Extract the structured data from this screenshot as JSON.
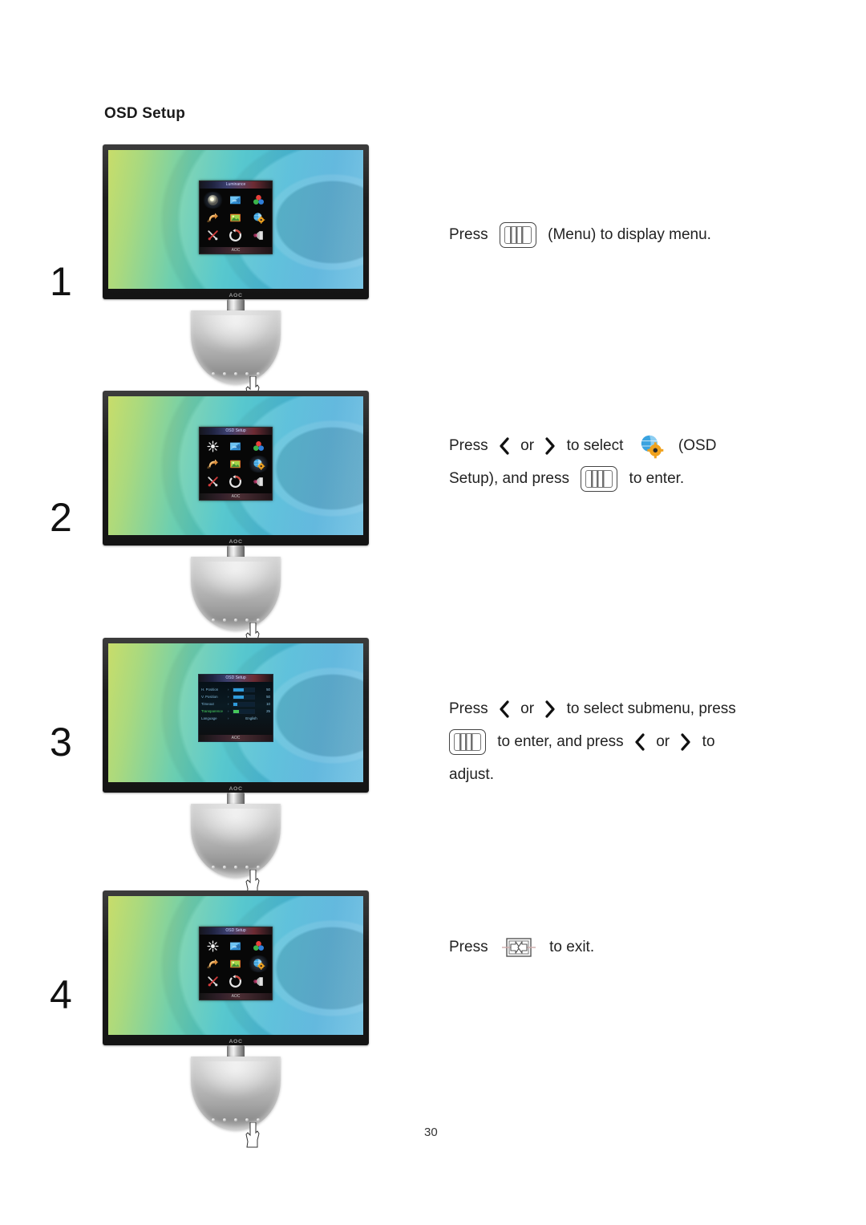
{
  "document": {
    "section_title": "OSD Setup",
    "page_number": "30"
  },
  "osd_menu": {
    "title": "Luminance",
    "brand": "AOC",
    "icons": [
      {
        "name": "luminance-icon",
        "label": "Luminance"
      },
      {
        "name": "image-setup-icon",
        "label": "Image Setup"
      },
      {
        "name": "color-setup-icon",
        "label": "Color Setup"
      },
      {
        "name": "picture-boost-icon",
        "label": "Picture Boost"
      },
      {
        "name": "picture-preview-icon",
        "label": "Picture Preview"
      },
      {
        "name": "osd-setup-icon",
        "label": "OSD Setup"
      },
      {
        "name": "extra-icon",
        "label": "Extra"
      },
      {
        "name": "reset-icon",
        "label": "Reset"
      },
      {
        "name": "exit-icon",
        "label": "Exit"
      }
    ]
  },
  "osd_submenu": {
    "title": "OSD Setup",
    "brand": "AOC",
    "rows": [
      {
        "label": "H. Position",
        "type": "bar",
        "value": "50",
        "percent": 50,
        "active": false
      },
      {
        "label": "V. Position",
        "type": "bar",
        "value": "50",
        "percent": 50,
        "active": false
      },
      {
        "label": "Timeout",
        "type": "bar",
        "value": "10",
        "percent": 18,
        "active": false
      },
      {
        "label": "Transparence",
        "type": "bar",
        "value": "25",
        "percent": 25,
        "active": true
      },
      {
        "label": "Language",
        "type": "option",
        "value": "English",
        "percent": 0,
        "active": false
      }
    ]
  },
  "steps": [
    {
      "number": "1",
      "monitor_state": "menu-closed-highlight-luminance",
      "selected_index": 0,
      "instruction": {
        "lines": [
          [
            {
              "kind": "text",
              "value": "Press "
            },
            {
              "kind": "key",
              "value": "menu-button"
            },
            {
              "kind": "text",
              "value": " (Menu) to display menu."
            }
          ]
        ]
      }
    },
    {
      "number": "2",
      "monitor_state": "menu-open-highlight-osd-setup",
      "selected_index": 5,
      "instruction": {
        "lines": [
          [
            {
              "kind": "text",
              "value": "Press "
            },
            {
              "kind": "chev",
              "value": "chevron-left"
            },
            {
              "kind": "text",
              "value": " or "
            },
            {
              "kind": "chev",
              "value": "chevron-right"
            },
            {
              "kind": "text",
              "value": " to select "
            },
            {
              "kind": "icon",
              "value": "osd-setup-icon"
            },
            {
              "kind": "text",
              "value": " (OSD"
            }
          ],
          [
            {
              "kind": "text",
              "value": "Setup), and press "
            },
            {
              "kind": "key",
              "value": "menu-button"
            },
            {
              "kind": "text",
              "value": " to enter."
            }
          ]
        ]
      }
    },
    {
      "number": "3",
      "monitor_state": "submenu-open",
      "selected_index": 5,
      "instruction": {
        "lines": [
          [
            {
              "kind": "text",
              "value": "Press "
            },
            {
              "kind": "chev",
              "value": "chevron-left"
            },
            {
              "kind": "text",
              "value": " or "
            },
            {
              "kind": "chev",
              "value": "chevron-right"
            },
            {
              "kind": "text",
              "value": " to select submenu, press"
            }
          ],
          [
            {
              "kind": "key",
              "value": "menu-button"
            },
            {
              "kind": "text",
              "value": " to enter, and press "
            },
            {
              "kind": "chev",
              "value": "chevron-left"
            },
            {
              "kind": "text",
              "value": " or "
            },
            {
              "kind": "chev",
              "value": "chevron-right"
            },
            {
              "kind": "text",
              "value": " to"
            }
          ],
          [
            {
              "kind": "text",
              "value": "adjust."
            }
          ]
        ]
      }
    },
    {
      "number": "4",
      "monitor_state": "menu-open-highlight-osd-setup",
      "selected_index": 5,
      "instruction": {
        "lines": [
          [
            {
              "kind": "text",
              "value": "Press "
            },
            {
              "kind": "key",
              "value": "exit-button"
            },
            {
              "kind": "text",
              "value": " to exit."
            }
          ]
        ]
      }
    }
  ],
  "colors": {
    "screen_green": "#c8dd6a",
    "screen_cyan": "#45c2c8",
    "screen_blue": "#3aa6d6",
    "osd_background": "#050505",
    "submenu_active": "#49d760",
    "submenu_text": "#7fb6d8",
    "bezel": "#1e1e1e",
    "stand": "#c2c2c2"
  }
}
